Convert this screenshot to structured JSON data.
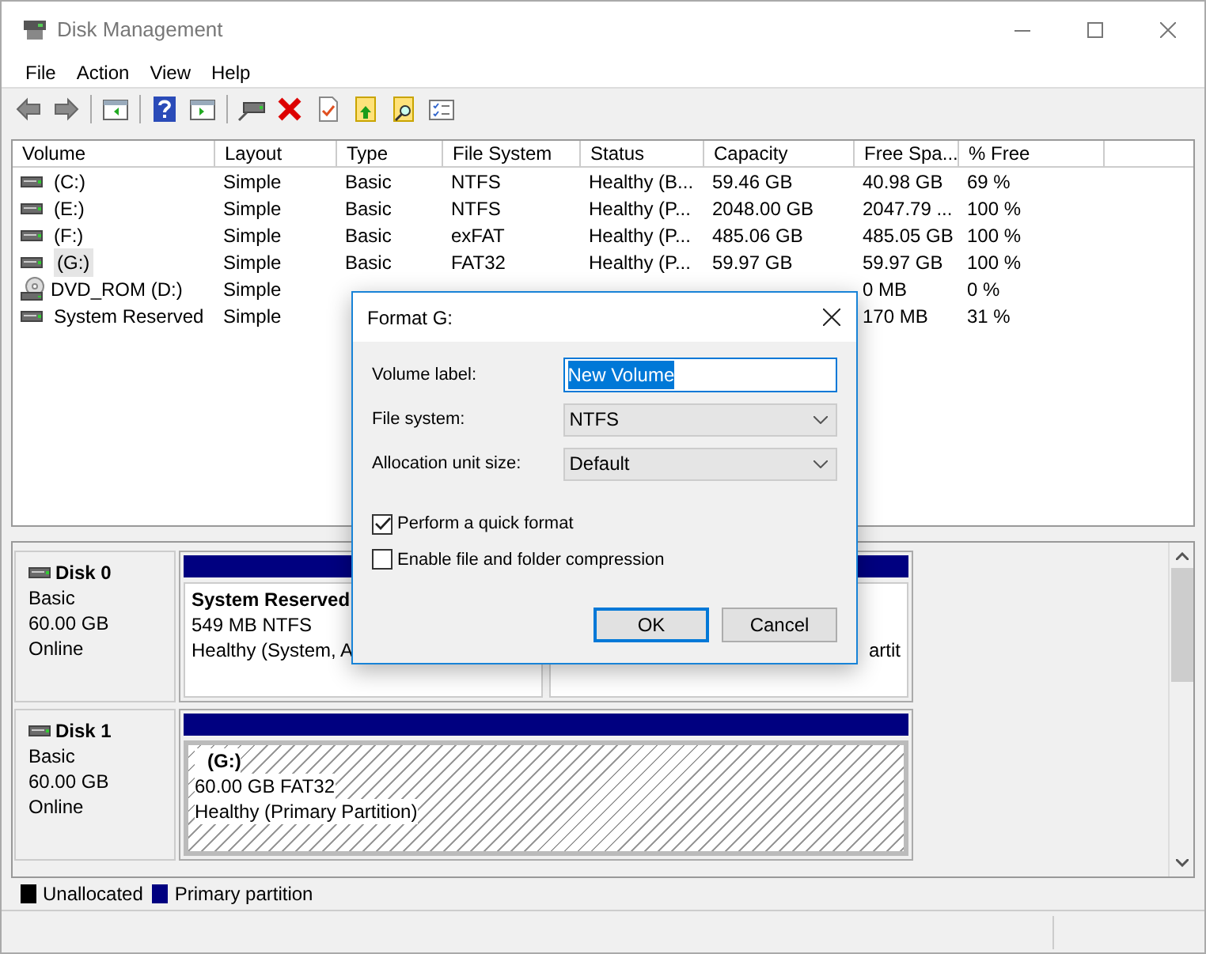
{
  "window": {
    "title": "Disk Management"
  },
  "menu": [
    "File",
    "Action",
    "View",
    "Help"
  ],
  "columns": [
    "Volume",
    "Layout",
    "Type",
    "File System",
    "Status",
    "Capacity",
    "Free Spa...",
    "% Free"
  ],
  "rows": [
    {
      "kind": "drive",
      "selected": false,
      "cells": [
        "(C:)",
        "Simple",
        "Basic",
        "NTFS",
        "Healthy (B...",
        "59.46 GB",
        "40.98 GB",
        "69 %"
      ]
    },
    {
      "kind": "drive",
      "selected": false,
      "cells": [
        "(E:)",
        "Simple",
        "Basic",
        "NTFS",
        "Healthy (P...",
        "2048.00 GB",
        "2047.79 ...",
        "100 %"
      ]
    },
    {
      "kind": "drive",
      "selected": false,
      "cells": [
        "(F:)",
        "Simple",
        "Basic",
        "exFAT",
        "Healthy (P...",
        "485.06 GB",
        "485.05 GB",
        "100 %"
      ]
    },
    {
      "kind": "drive",
      "selected": true,
      "cells": [
        "(G:)",
        "Simple",
        "Basic",
        "FAT32",
        "Healthy (P...",
        "59.97 GB",
        "59.97 GB",
        "100 %"
      ]
    },
    {
      "kind": "optical",
      "selected": false,
      "cells": [
        "DVD_ROM (D:)",
        "Simple",
        null,
        null,
        null,
        null,
        "0 MB",
        "0 %"
      ]
    },
    {
      "kind": "drive",
      "selected": false,
      "cells": [
        "System Reserved",
        "Simple",
        null,
        null,
        null,
        null,
        "170 MB",
        "31 %"
      ]
    }
  ],
  "disks": [
    {
      "name": "Disk 0",
      "type": "Basic",
      "size": "60.00 GB",
      "state": "Online",
      "partitions": [
        {
          "selected": false,
          "label": "System Reserved",
          "detail": "549 MB NTFS",
          "status": "Healthy (System, A"
        },
        {
          "selected": false,
          "status": "artit"
        }
      ]
    },
    {
      "name": "Disk 1",
      "type": "Basic",
      "size": "60.00 GB",
      "state": "Online",
      "partitions": [
        {
          "selected": true,
          "label": "(G:)",
          "detail": "60.00 GB FAT32",
          "status": "Healthy (Primary Partition)"
        }
      ]
    }
  ],
  "legend": [
    {
      "label": "Unallocated",
      "color": "#000000"
    },
    {
      "label": "Primary partition",
      "color": "#000080"
    }
  ],
  "dialog": {
    "title": "Format G:",
    "fields": [
      {
        "kind": "text",
        "label": "Volume label:",
        "value": "New Volume"
      },
      {
        "kind": "select",
        "label": "File system:",
        "value": "NTFS"
      },
      {
        "kind": "select",
        "label": "Allocation unit size:",
        "value": "Default"
      }
    ],
    "options": [
      {
        "label": "Perform a quick format",
        "checked": true
      },
      {
        "label": "Enable file and folder compression",
        "checked": false
      }
    ],
    "buttons": [
      {
        "label": "OK",
        "default": true
      },
      {
        "label": "Cancel",
        "default": false
      }
    ]
  }
}
